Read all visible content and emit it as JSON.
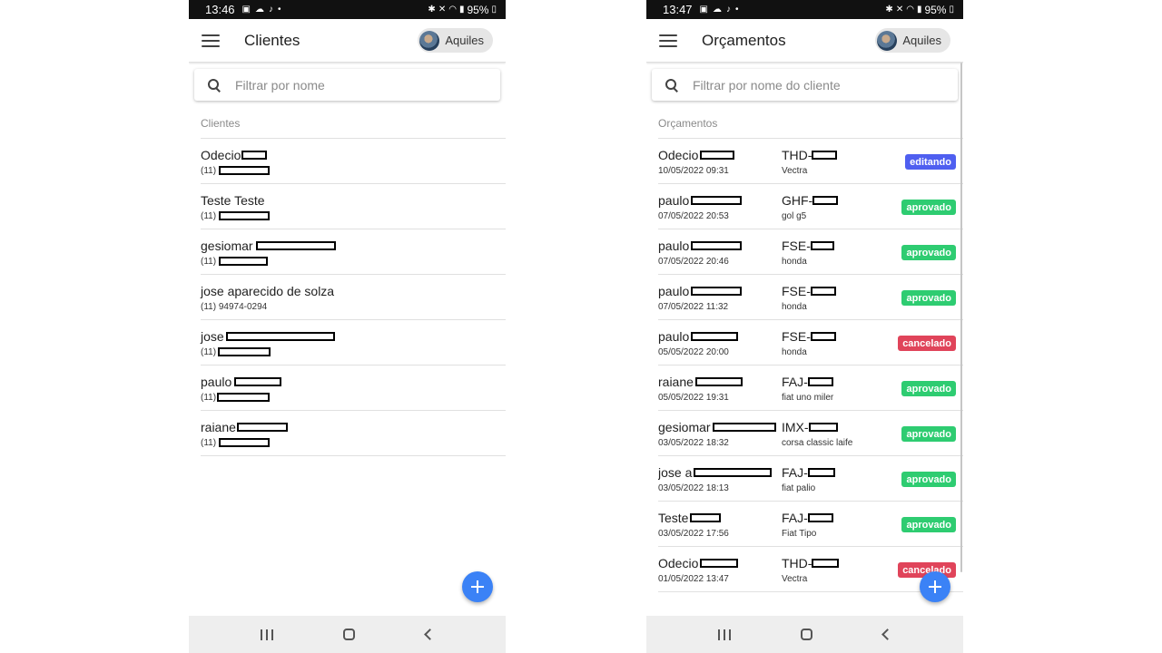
{
  "left": {
    "status": {
      "time": "13:46",
      "battery": "95%"
    },
    "appbar": {
      "title": "Clientes",
      "user": "Aquiles"
    },
    "search": {
      "placeholder": "Filtrar por nome"
    },
    "section": "Clientes",
    "clients": [
      {
        "name": "Odecio",
        "phone": "(11)"
      },
      {
        "name": "Teste Teste",
        "phone": "(11)"
      },
      {
        "name": "gesiomar",
        "phone": "(11)"
      },
      {
        "name": "jose aparecido de solza",
        "phone": "(11) 94974-0294"
      },
      {
        "name": "jose",
        "phone": "(11)"
      },
      {
        "name": "paulo",
        "phone": "(11)"
      },
      {
        "name": "raiane",
        "phone": "(11)"
      }
    ]
  },
  "right": {
    "status": {
      "time": "13:47",
      "battery": "95%"
    },
    "appbar": {
      "title": "Orçamentos",
      "user": "Aquiles"
    },
    "search": {
      "placeholder": "Filtrar por nome do cliente"
    },
    "section": "Orçamentos",
    "quotes": [
      {
        "client": "Odecio",
        "date": "10/05/2022 09:31",
        "plate": "THD-",
        "vehicle": "Vectra",
        "status": "editando"
      },
      {
        "client": "paulo",
        "date": "07/05/2022 20:53",
        "plate": "GHF-",
        "vehicle": "gol g5",
        "status": "aprovado"
      },
      {
        "client": "paulo",
        "date": "07/05/2022 20:46",
        "plate": "FSE-",
        "vehicle": "honda",
        "status": "aprovado"
      },
      {
        "client": "paulo",
        "date": "07/05/2022 11:32",
        "plate": "FSE-",
        "vehicle": "honda",
        "status": "aprovado"
      },
      {
        "client": "paulo",
        "date": "05/05/2022 20:00",
        "plate": "FSE-",
        "vehicle": "honda",
        "status": "cancelado"
      },
      {
        "client": "raiane",
        "date": "05/05/2022 19:31",
        "plate": "FAJ-",
        "vehicle": "fiat uno miler",
        "status": "aprovado"
      },
      {
        "client": "gesiomar",
        "date": "03/05/2022 18:32",
        "plate": "IMX-",
        "vehicle": "corsa classic laife",
        "status": "aprovado"
      },
      {
        "client": "jose a",
        "date": "03/05/2022 18:13",
        "plate": "FAJ-",
        "vehicle": "fiat palio",
        "status": "aprovado"
      },
      {
        "client": "Teste",
        "date": "03/05/2022 17:56",
        "plate": "FAJ-",
        "vehicle": "Fiat Tipo",
        "status": "aprovado"
      },
      {
        "client": "Odecio",
        "date": "01/05/2022 13:47",
        "plate": "THD-",
        "vehicle": "Vectra",
        "status": "cancelado"
      }
    ]
  },
  "colors": {
    "editando": "#4f5ff0",
    "aprovado": "#2ecc71",
    "cancelado": "#e0445a",
    "fab": "#3b82f6"
  },
  "icons": [
    "menu-icon",
    "search-icon",
    "plus-icon",
    "avatar",
    "recents-icon",
    "home-icon",
    "back-icon"
  ]
}
